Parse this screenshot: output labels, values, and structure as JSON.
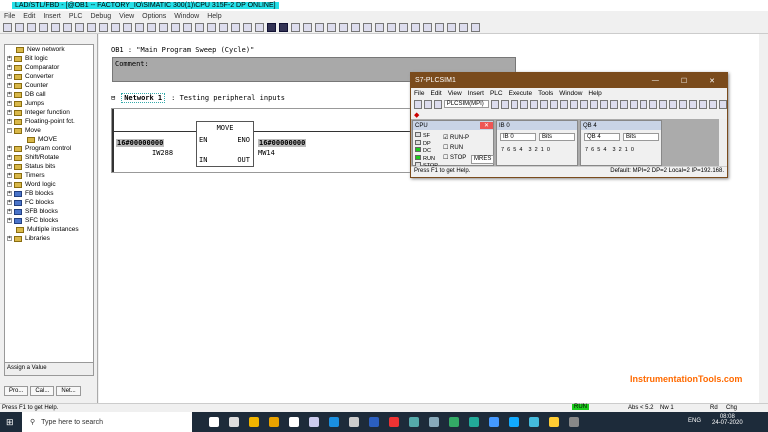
{
  "window": {
    "title": "LAD/STL/FBD - [@OB1 -- FACTORY_IO\\SIMATIC 300(1)\\CPU 315F-2 DP ONLINE]"
  },
  "menu": [
    "File",
    "Edit",
    "Insert",
    "PLC",
    "Debug",
    "View",
    "Options",
    "Window",
    "Help"
  ],
  "catalog": {
    "items": [
      {
        "label": "New network",
        "type": "leaf"
      },
      {
        "label": "Bit logic"
      },
      {
        "label": "Comparator"
      },
      {
        "label": "Converter"
      },
      {
        "label": "Counter"
      },
      {
        "label": "DB call"
      },
      {
        "label": "Jumps"
      },
      {
        "label": "Integer function"
      },
      {
        "label": "Floating-point fct."
      },
      {
        "label": "Move",
        "expanded": true
      },
      {
        "label": "MOVE",
        "type": "child"
      },
      {
        "label": "Program control"
      },
      {
        "label": "Shift/Rotate"
      },
      {
        "label": "Status bits"
      },
      {
        "label": "Timers"
      },
      {
        "label": "Word logic"
      },
      {
        "label": "FB blocks",
        "blue": true
      },
      {
        "label": "FC blocks",
        "blue": true
      },
      {
        "label": "SFB blocks",
        "blue": true
      },
      {
        "label": "SFC blocks",
        "blue": true
      },
      {
        "label": "Multiple instances",
        "type": "leaf"
      },
      {
        "label": "Libraries"
      }
    ],
    "info": "Assign a Value",
    "tabs": [
      "Pro...",
      "Cal...",
      "Net..."
    ]
  },
  "editor": {
    "block": "OB1 :   \"Main Program Sweep (Cycle)\"",
    "comment": "Comment:",
    "network": "Network 1",
    "network_title": ": Testing peripheral inputs",
    "move": {
      "name": "MOVE",
      "en": "EN",
      "eno": "ENO",
      "in": "IN",
      "out": "OUT",
      "in_value": "16#00000000",
      "in_addr": "IW288",
      "out_value": "16#00000000",
      "out_addr": "MW14"
    }
  },
  "plcsim": {
    "title": "S7-PLCSIM1",
    "menu": [
      "File",
      "Edit",
      "View",
      "Insert",
      "PLC",
      "Execute",
      "Tools",
      "Window",
      "Help"
    ],
    "connection": "PLCSIM(MPI)",
    "cpu": {
      "title": "CPU",
      "leds": [
        {
          "label": "SF",
          "on": false
        },
        {
          "label": "DP",
          "on": false
        },
        {
          "label": "DC",
          "on": true
        },
        {
          "label": "RUN",
          "on": true
        },
        {
          "label": "STOP",
          "on": false
        }
      ],
      "modes": [
        {
          "label": "RUN-P",
          "checked": true
        },
        {
          "label": "RUN",
          "checked": false
        },
        {
          "label": "STOP",
          "checked": false
        }
      ],
      "mres": "MRES"
    },
    "ib": {
      "title": "IB 0",
      "addr": "IB   0",
      "format": "Bits",
      "bits": "7  6  5  4    3  2  1  0"
    },
    "qb": {
      "title": "QB 4",
      "addr": "QB   4",
      "format": "Bits",
      "bits": "7  6  5  4    3  2  1  0"
    },
    "status_left": "Press F1 to get Help.",
    "status_right": "Default:  MPI=2 DP=2 Local=2 IP=192.168."
  },
  "status": {
    "help": "Press F1 to get Help.",
    "mode": "RUN",
    "abs": "Abs < 5.2",
    "nw": "Nw 1",
    "rd": "Rd",
    "chg": "Chg"
  },
  "taskbar": {
    "search": "Type here to search",
    "lang": "ENG",
    "time": "08:08",
    "date": "24-07-2020"
  },
  "watermark": "InstrumentationTools.com",
  "colors": {
    "title_highlight": "#26e0e8",
    "plcsim_title": "#7a4b1c",
    "run_green": "#1ccc1c"
  }
}
